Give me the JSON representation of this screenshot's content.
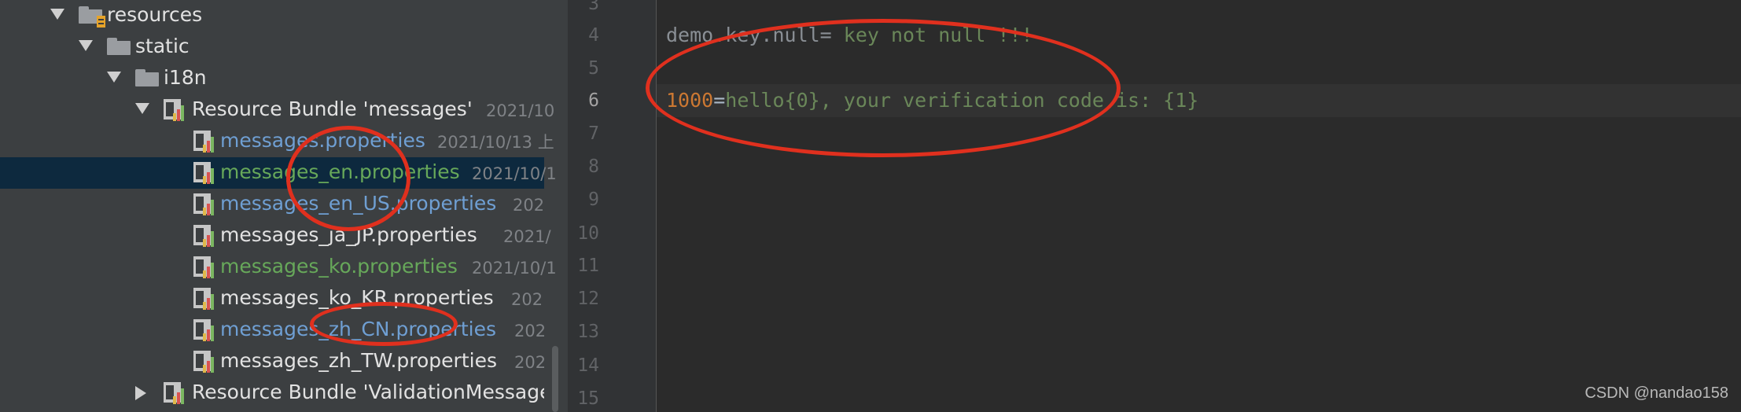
{
  "tree": {
    "items": [
      {
        "label": "resources",
        "date": ""
      },
      {
        "label": "static",
        "date": ""
      },
      {
        "label": "i18n",
        "date": ""
      },
      {
        "label": "Resource Bundle 'messages'",
        "date": "2021/10"
      },
      {
        "label": "messages.properties",
        "date": "2021/10/13 上"
      },
      {
        "label": "messages_en.properties",
        "date": "2021/10/1"
      },
      {
        "label": "messages_en_US.properties",
        "date": "202"
      },
      {
        "label": "messages_ja_JP.properties",
        "date": "2021/"
      },
      {
        "label": "messages_ko.properties",
        "date": "2021/10/1"
      },
      {
        "label": "messages_ko_KR.properties",
        "date": "202"
      },
      {
        "label": "messages_zh_CN.properties",
        "date": "202"
      },
      {
        "label": "messages_zh_TW.properties",
        "date": "202"
      },
      {
        "label": "Resource Bundle 'ValidationMessages'",
        "date": ""
      }
    ]
  },
  "editor": {
    "line_numbers": [
      "3",
      "4",
      "5",
      "6",
      "7",
      "8",
      "9",
      "10",
      "11",
      "12",
      "13",
      "14",
      "15"
    ],
    "current_line": "6",
    "line4": {
      "key": "demo.key.null",
      "eq": "=",
      "value": " key not null !!!"
    },
    "line6": {
      "key": "1000",
      "eq": "=",
      "value": "hello{0}, your verification code is: {1}"
    }
  },
  "watermark": "CSDN @nandao158",
  "colors": {
    "selection": "#0d293e",
    "annotation": "#e0301e",
    "properties_blue": "#6f9fd3",
    "properties_green": "#67a85a"
  }
}
